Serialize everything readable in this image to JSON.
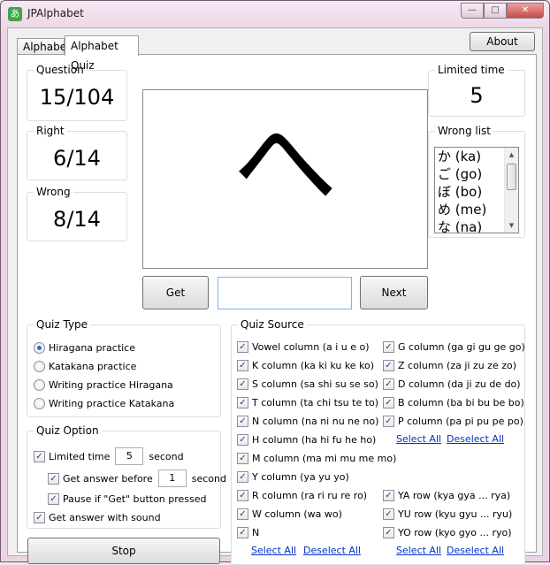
{
  "window": {
    "title": "JPAlphabet",
    "icon_glyph": "あ",
    "minimize": "—",
    "maximize": "□",
    "close": "✕"
  },
  "tabs": [
    {
      "label": "Alphabet"
    },
    {
      "label": "Alphabet Quiz"
    }
  ],
  "about_label": "About",
  "stats": {
    "question": {
      "title": "Question",
      "value": "15/104"
    },
    "right": {
      "title": "Right",
      "value": "6/14"
    },
    "wrong": {
      "title": "Wrong",
      "value": "8/14"
    },
    "limited_time": {
      "title": "Limited time",
      "value": "5"
    }
  },
  "quiz_char": "へ",
  "wrong_list": {
    "title": "Wrong list",
    "items": [
      "か (ka)",
      "ご (go)",
      "ぼ (bo)",
      "め (me)",
      "な (na)"
    ]
  },
  "answer_input": {
    "value": ""
  },
  "buttons": {
    "get": "Get",
    "next": "Next",
    "stop": "Stop"
  },
  "quiz_type": {
    "title": "Quiz Type",
    "options": [
      {
        "label": "Hiragana practice",
        "selected": true
      },
      {
        "label": "Katakana practice",
        "selected": false
      },
      {
        "label": "Writing practice Hiragana",
        "selected": false
      },
      {
        "label": "Writing practice Katakana",
        "selected": false
      }
    ]
  },
  "quiz_option": {
    "title": "Quiz Option",
    "limited_time_label": "Limited time",
    "limited_time_value": "5",
    "limited_time_unit": "second",
    "get_answer_before_label": "Get answer before",
    "get_answer_before_value": "1",
    "get_answer_before_unit": "second",
    "pause_label": "Pause if \"Get\" button pressed",
    "sound_label": "Get answer with sound"
  },
  "quiz_source": {
    "title": "Quiz Source",
    "left_items": [
      "Vowel column (a i u e o)",
      "K column (ka ki ku ke ko)",
      "S column (sa shi su se so)",
      "T column (ta chi tsu te to)",
      "N column (na ni nu ne no)",
      "H column (ha hi fu he ho)",
      "M column (ma mi mu me mo)",
      "Y column (ya yu yo)",
      "R column (ra ri ru re ro)",
      "W column (wa wo)",
      "N"
    ],
    "right_items": [
      "G column (ga gi gu ge go)",
      "Z column (za ji zu ze zo)",
      "D column (da ji zu de do)",
      "B column (ba bi bu be bo)",
      "P column (pa pi pu pe po)"
    ],
    "yoon_items": [
      "YA row (kya gya ... rya)",
      "YU row (kyu gyu ... ryu)",
      "YO row (kyo gyo ... ryo)"
    ],
    "select_all": "Select All",
    "deselect_all": "Deselect All"
  },
  "check_mark": "✓",
  "scroll_up": "▲",
  "scroll_down": "▼"
}
